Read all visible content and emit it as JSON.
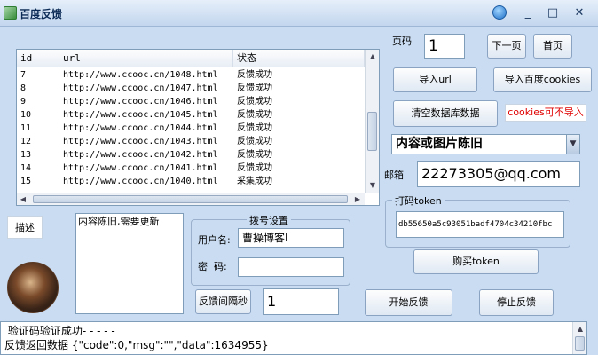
{
  "window": {
    "title": "百度反馈",
    "minimize": "_",
    "maximize": "□",
    "close": "✕"
  },
  "table": {
    "headers": [
      "id",
      "url",
      "状态"
    ],
    "rows": [
      {
        "id": "7",
        "url": "http://www.ccooc.cn/1048.html",
        "status": "反馈成功"
      },
      {
        "id": "8",
        "url": "http://www.ccooc.cn/1047.html",
        "status": "反馈成功"
      },
      {
        "id": "9",
        "url": "http://www.ccooc.cn/1046.html",
        "status": "反馈成功"
      },
      {
        "id": "10",
        "url": "http://www.ccooc.cn/1045.html",
        "status": "反馈成功"
      },
      {
        "id": "11",
        "url": "http://www.ccooc.cn/1044.html",
        "status": "反馈成功"
      },
      {
        "id": "12",
        "url": "http://www.ccooc.cn/1043.html",
        "status": "反馈成功"
      },
      {
        "id": "13",
        "url": "http://www.ccooc.cn/1042.html",
        "status": "反馈成功"
      },
      {
        "id": "14",
        "url": "http://www.ccooc.cn/1041.html",
        "status": "反馈成功"
      },
      {
        "id": "15",
        "url": "http://www.ccooc.cn/1040.html",
        "status": "采集成功"
      }
    ]
  },
  "pager": {
    "label": "页码",
    "value": "1",
    "next": "下一页",
    "first": "首页"
  },
  "buttons": {
    "import_url": "导入url",
    "import_cookies": "导入百度cookies",
    "clear_db": "清空数据库数据",
    "cookies_warning": "cookies可不导入",
    "buy_token": "购买token",
    "start": "开始反馈",
    "stop": "停止反馈"
  },
  "reason_select": {
    "value": "内容或图片陈旧"
  },
  "email": {
    "label": "邮箱",
    "value": "22273305@qq.com"
  },
  "token": {
    "label": "打码token",
    "value": "db55650a5c93051badf4704c34210fbc"
  },
  "description": {
    "label": "描述",
    "value": "内容陈旧,需要更新"
  },
  "account": {
    "group_title": "拨号设置",
    "username_label": "用户名:",
    "username_value": "曹操博客l",
    "password_label": "密  码:",
    "password_value": ""
  },
  "interval": {
    "label": "反馈间隔秒",
    "value": "1"
  },
  "log": {
    "line1": " 验证码验证成功- - - - -",
    "line2": "反馈返回数据 {\"code\":0,\"msg\":\"\",\"data\":1634955}"
  },
  "colors": {
    "window_bg": "#c9dcf2",
    "warning_text": "#e00000"
  }
}
